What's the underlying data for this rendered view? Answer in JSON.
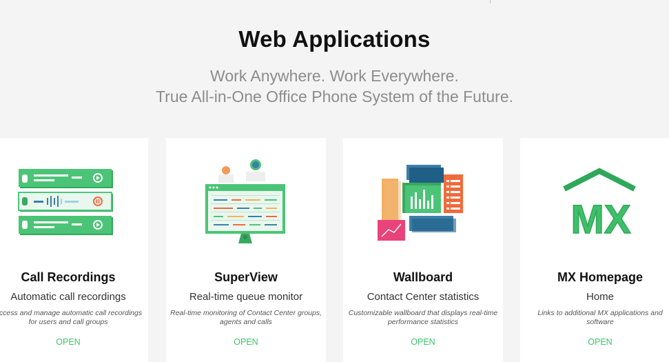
{
  "hero": {
    "title": "Web Applications",
    "subtitle_line1": "Work Anywhere. Work Everywhere.",
    "subtitle_line2": "True All-in-One Office Phone System of the Future."
  },
  "cards": [
    {
      "title": "Call Recordings",
      "subtitle": "Automatic call recordings",
      "description": "Access and manage automatic call recordings for users and call groups",
      "action": "OPEN",
      "icon": "call-recordings-icon"
    },
    {
      "title": "SuperView",
      "subtitle": "Real-time queue monitor",
      "description": "Real-time monitoring of Contact Center groups, agents and calls",
      "action": "OPEN",
      "icon": "superview-monitor-icon"
    },
    {
      "title": "Wallboard",
      "subtitle": "Contact Center statistics",
      "description": "Customizable wallboard that displays real-time performance statistics",
      "action": "OPEN",
      "icon": "wallboard-icon"
    },
    {
      "title": "MX Homepage",
      "subtitle": "Home",
      "description": "Links to additional MX applications and software",
      "action": "OPEN",
      "icon": "mx-homepage-icon"
    }
  ],
  "colors": {
    "accent_green": "#3cc46a",
    "background": "#f4f4f4"
  }
}
